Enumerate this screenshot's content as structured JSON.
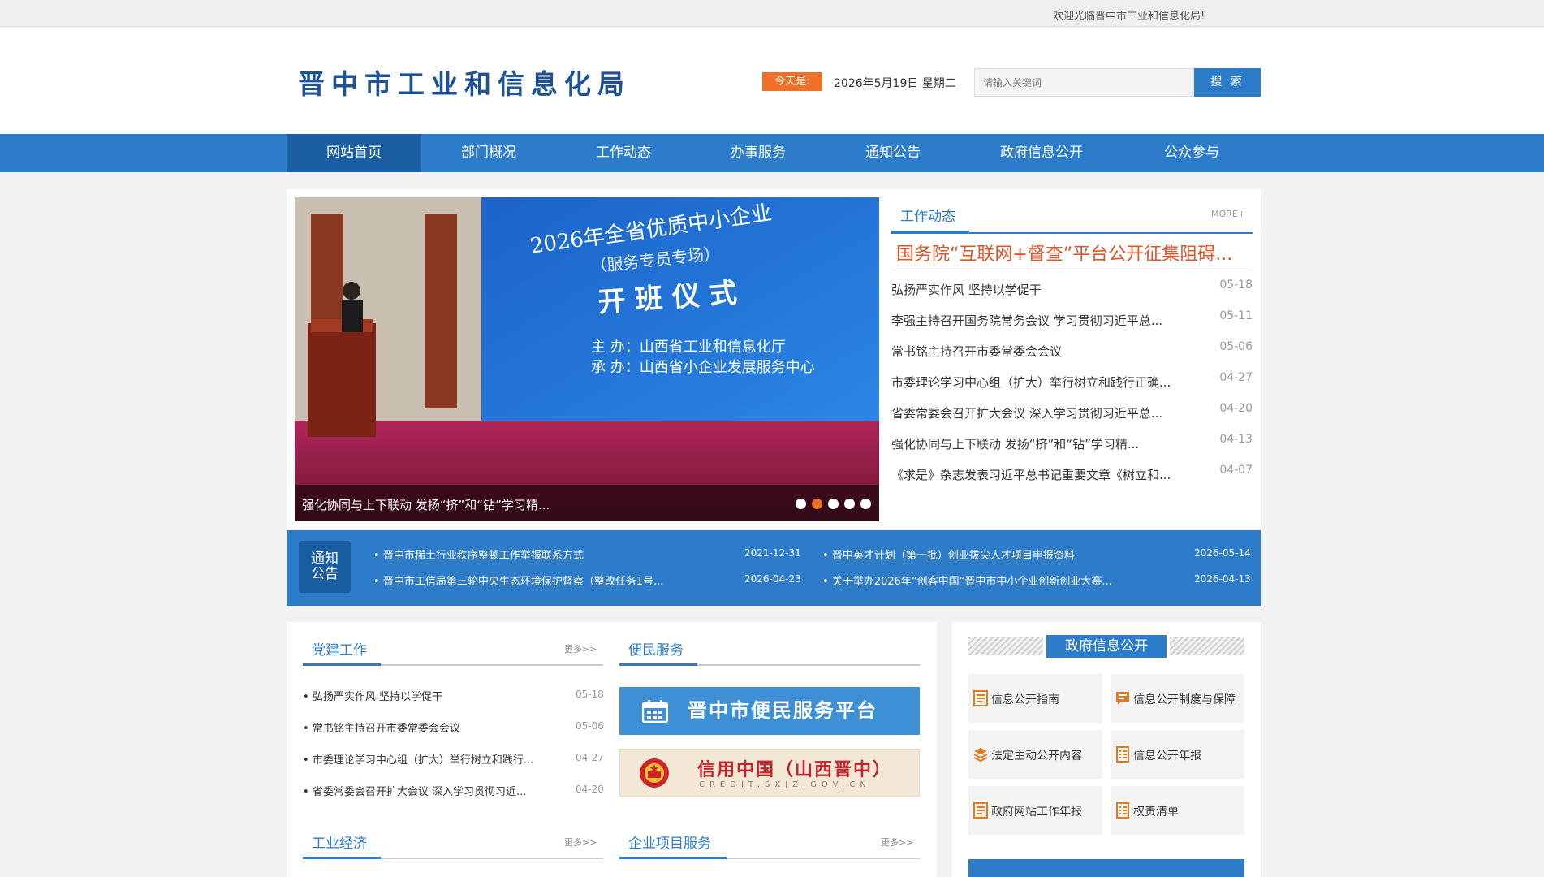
{
  "topbar": {
    "welcome": "欢迎光临晋中市工业和信息化局!"
  },
  "header": {
    "logo": "晋中市工业和信息化局",
    "today_label": "今天是:",
    "today_date": "2026年5月19日 星期二",
    "search_placeholder": "请输入关键词",
    "search_button": "搜 索"
  },
  "nav": {
    "items": [
      "网站首页",
      "部门概况",
      "工作动态",
      "办事服务",
      "通知公告",
      "政府信息公开",
      "公众参与"
    ],
    "active": "网站首页"
  },
  "slider": {
    "caption": "强化协同与上下联动 发扬“挤”和“钻”学习精...",
    "active_dot": 2,
    "screen_title": "2026年全省优质中小企业",
    "screen_subtitle": "（服务专员专场）",
    "screen_ceremony": "开 班 仪 式",
    "screen_host": "主 办：山西省工业和信息化厅",
    "screen_organizer": "承 办：山西省小企业发展服务中心"
  },
  "news": {
    "tab": "工作动态",
    "more": "MORE+",
    "headline": "国务院“互联网+督查”平台公开征集阻碍...",
    "items": [
      {
        "title": "弘扬严实作风 坚持以学促干",
        "date": "05-18"
      },
      {
        "title": "李强主持召开国务院常务会议 学习贯彻习近平总...",
        "date": "05-11"
      },
      {
        "title": "常书铭主持召开市委常委会会议",
        "date": "05-06"
      },
      {
        "title": "市委理论学习中心组（扩大）举行树立和践行正确...",
        "date": "04-27"
      },
      {
        "title": "省委常委会召开扩大会议 深入学习贯彻习近平总...",
        "date": "04-20"
      },
      {
        "title": "强化协同与上下联动 发扬“挤”和“钻”学习精...",
        "date": "04-13"
      },
      {
        "title": "《求是》杂志发表习近平总书记重要文章《树立和...",
        "date": "04-07"
      }
    ]
  },
  "notice": {
    "label_line1": "通知",
    "label_line2": "公告",
    "items": [
      {
        "title": "晋中市稀土行业秩序整顿工作举报联系方式",
        "date": "2021-12-31"
      },
      {
        "title": "晋中英才计划（第一批）创业拔尖人才项目申报资料",
        "date": "2026-05-14"
      },
      {
        "title": "晋中市工信局第三轮中央生态环境保护督察（整改任务1号...",
        "date": "2026-04-23"
      },
      {
        "title": "关于举办2026年“创客中国”晋中市中小企业创新创业大赛...",
        "date": "2026-04-13"
      }
    ]
  },
  "party": {
    "title": "党建工作",
    "more": "更多>>",
    "items": [
      {
        "title": "弘扬严实作风 坚持以学促干",
        "date": "05-18"
      },
      {
        "title": "常书铭主持召开市委常委会会议",
        "date": "05-06"
      },
      {
        "title": "市委理论学习中心组（扩大）举行树立和践行...",
        "date": "04-27"
      },
      {
        "title": "省委常委会召开扩大会议 深入学习贯彻习近...",
        "date": "04-20"
      }
    ]
  },
  "service": {
    "title": "便民服务",
    "platform": "晋中市便民服务平台",
    "credit_main": "信用中国（山西晋中）",
    "credit_sub": "CREDIT.SXJZ.GOV.CN"
  },
  "industry": {
    "title": "工业经济",
    "more": "更多>>"
  },
  "enterprise": {
    "title": "企业项目服务",
    "more": "更多>>"
  },
  "gov": {
    "title": "政府信息公开",
    "tiles": [
      "信息公开指南",
      "信息公开制度与保障",
      "法定主动公开内容",
      "信息公开年报",
      "政府网站工作年报",
      "权责清单"
    ]
  },
  "colors": {
    "primary": "#2d7cc9",
    "dark": "#1b5da2",
    "accent": "#f07025",
    "headline": "#e0542a"
  }
}
